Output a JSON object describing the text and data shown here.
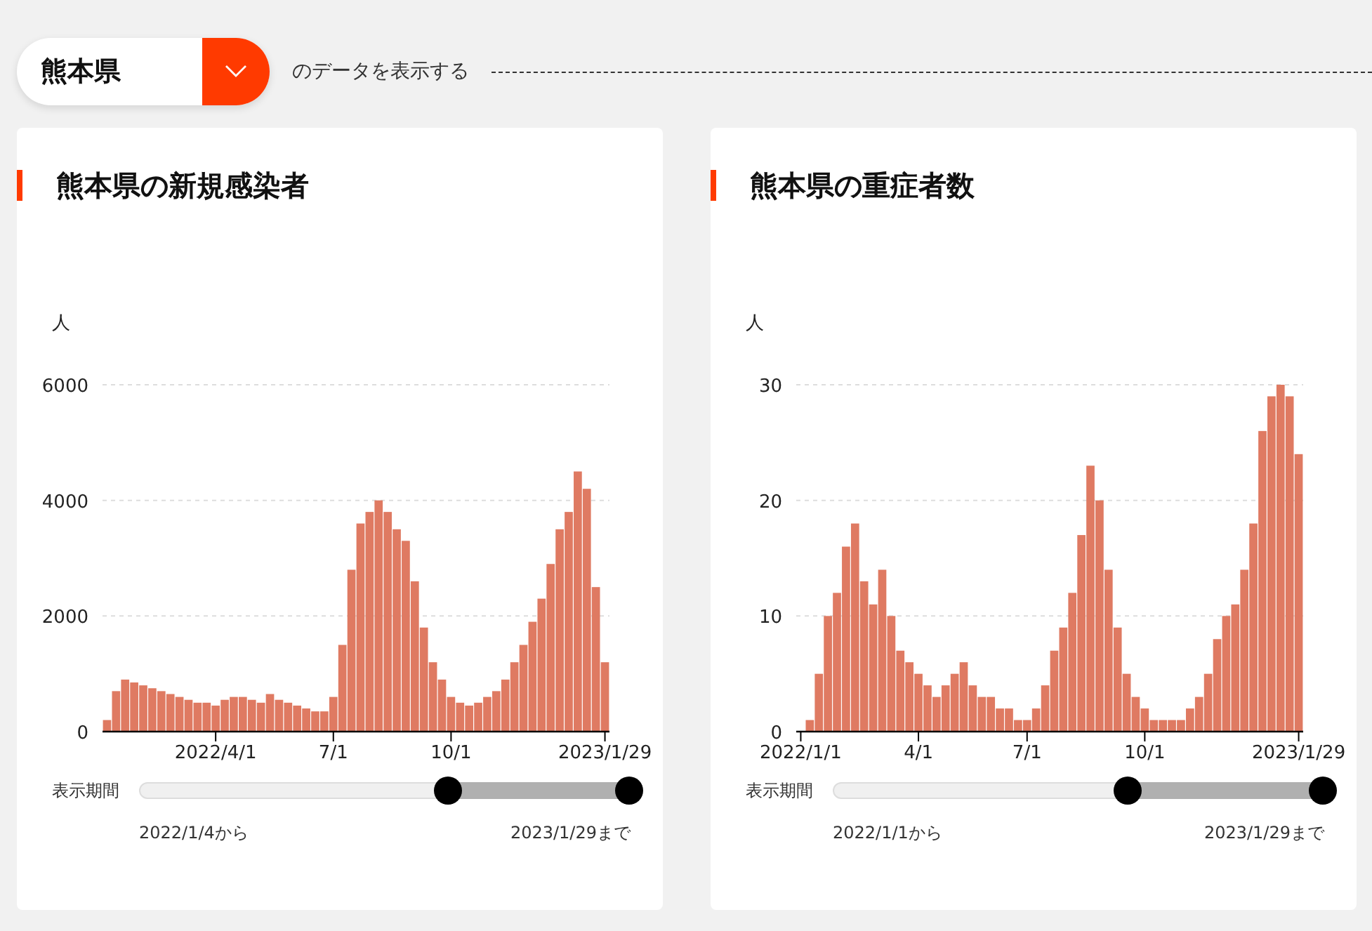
{
  "selector": {
    "value": "熊本県",
    "suffix": "のデータを表示する"
  },
  "cards": [
    {
      "title": "熊本県の新規感染者",
      "chart_data": {
        "type": "bar",
        "ylabel": "人",
        "grid": true,
        "ylim": [
          0,
          6000
        ],
        "yticks": [
          0,
          2000,
          4000,
          6000
        ],
        "categories": [
          null,
          null,
          null,
          null,
          null,
          null,
          null,
          null,
          null,
          null,
          null,
          null,
          "2022/4/1",
          null,
          null,
          null,
          null,
          null,
          null,
          null,
          null,
          null,
          null,
          null,
          null,
          "7/1",
          null,
          null,
          null,
          null,
          null,
          null,
          null,
          null,
          null,
          null,
          null,
          null,
          "10/1",
          null,
          null,
          null,
          null,
          null,
          null,
          null,
          null,
          null,
          null,
          null,
          null,
          null,
          null,
          null,
          null,
          "2023/1/29"
        ],
        "values": [
          200,
          700,
          900,
          850,
          800,
          750,
          700,
          650,
          600,
          550,
          500,
          500,
          450,
          550,
          600,
          600,
          550,
          500,
          650,
          550,
          500,
          450,
          400,
          350,
          350,
          600,
          1500,
          2800,
          3600,
          3800,
          4000,
          3800,
          3500,
          3300,
          2600,
          1800,
          1200,
          900,
          600,
          500,
          450,
          500,
          600,
          700,
          900,
          1200,
          1500,
          1900,
          2300,
          2900,
          3500,
          3800,
          4500,
          4200,
          2500,
          1200
        ]
      },
      "range": {
        "label": "表示期間",
        "thumbs": [
          {
            "level": 0.63
          },
          {
            "level": 1
          }
        ],
        "from": "2022/1/4から",
        "to": "2023/1/29まで"
      }
    },
    {
      "title": "熊本県の重症者数",
      "chart_data": {
        "type": "bar",
        "ylabel": "人",
        "grid": true,
        "ylim": [
          0,
          30
        ],
        "yticks": [
          0,
          10,
          20,
          30
        ],
        "categories": [
          "2022/1/1",
          null,
          null,
          null,
          null,
          null,
          null,
          null,
          null,
          null,
          null,
          null,
          null,
          "4/1",
          null,
          null,
          null,
          null,
          null,
          null,
          null,
          null,
          null,
          null,
          null,
          "7/1",
          null,
          null,
          null,
          null,
          null,
          null,
          null,
          null,
          null,
          null,
          null,
          null,
          "10/1",
          null,
          null,
          null,
          null,
          null,
          null,
          null,
          null,
          null,
          null,
          null,
          null,
          null,
          null,
          null,
          null,
          "2023/1/29"
        ],
        "values": [
          0,
          1,
          5,
          10,
          12,
          16,
          18,
          13,
          11,
          14,
          10,
          7,
          6,
          5,
          4,
          3,
          4,
          5,
          6,
          4,
          3,
          3,
          2,
          2,
          1,
          1,
          2,
          4,
          7,
          9,
          12,
          17,
          23,
          20,
          14,
          9,
          5,
          3,
          2,
          1,
          1,
          1,
          1,
          2,
          3,
          5,
          8,
          10,
          11,
          14,
          18,
          26,
          29,
          30,
          29,
          24
        ]
      },
      "range": {
        "label": "表示期間",
        "thumbs": [
          {
            "level": 0.6
          },
          {
            "level": 1
          }
        ],
        "from": "2022/1/1から",
        "to": "2023/1/29まで"
      }
    }
  ]
}
